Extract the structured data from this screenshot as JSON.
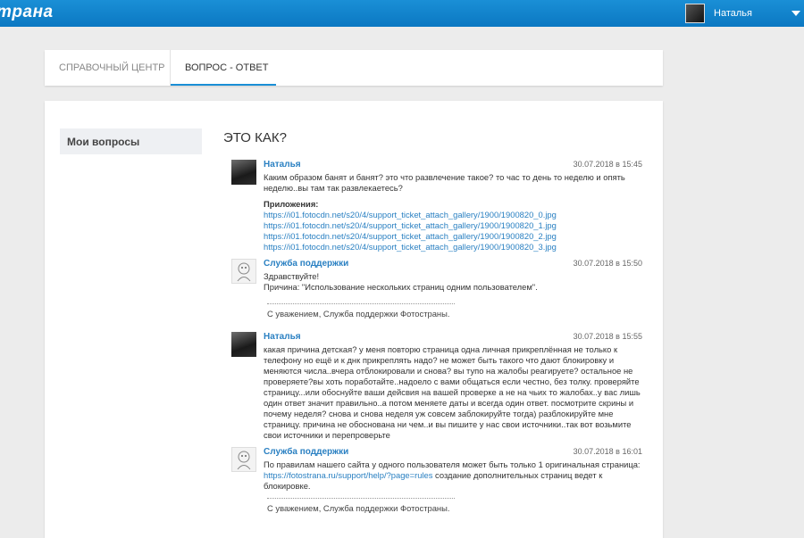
{
  "header": {
    "logo": "трана",
    "user_name": "Наталья"
  },
  "tabs": [
    {
      "label": "СПРАВОЧНЫЙ ЦЕНТР"
    },
    {
      "label": "ВОПРОС - ОТВЕТ"
    }
  ],
  "sidebar": {
    "item": "Мои вопросы"
  },
  "question": {
    "title": "ЭТО КАК?"
  },
  "messages": [
    {
      "author": "Наталья",
      "time": "30.07.2018 в 15:45",
      "text": "Каким образом банят и банят? это что развлечение такое? то час то день то неделю и опять неделю..вы там так развлекаетесь?",
      "attachments_label": "Приложения:",
      "attachments": [
        "https://i01.fotocdn.net/s20/4/support_ticket_attach_gallery/1900/1900820_0.jpg",
        "https://i01.fotocdn.net/s20/4/support_ticket_attach_gallery/1900/1900820_1.jpg",
        "https://i01.fotocdn.net/s20/4/support_ticket_attach_gallery/1900/1900820_2.jpg",
        "https://i01.fotocdn.net/s20/4/support_ticket_attach_gallery/1900/1900820_3.jpg"
      ]
    },
    {
      "author": "Служба поддержки",
      "time": "30.07.2018 в 15:50",
      "line1": "Здравствуйте!",
      "line2": "Причина: \"Использование нескольких страниц одним пользователем\".",
      "signature": "С уважением, Служба поддержки Фотостраны."
    },
    {
      "author": "Наталья",
      "time": "30.07.2018 в 15:55",
      "text": "какая причина детская? у меня повторю страница одна личная прикреплённая не только к телефону но ещё и к днк прикреплять надо? не может быть такого что дают блокировку и меняются числа..вчера отблокировали и снова? вы тупо на жалобы реагируете? остальное не проверяете?вы хоть поработайте..надоело с вами общаться если честно, без толку. проверяйте страницу...или обоснуйте ваши дейсвия на вашей проверке а не на чьих то жалобах..у вас лишь один ответ значит правильно..а потом меняете даты и всегда один ответ. посмотрите скрины и почему неделя? снова и снова неделя уж совсем заблокируйте тогда) разблокируйте мне страницу. причина не обоснована ни чем..и вы пишите у нас свои источники..так вот возьмите свои источники и перепроверьте"
    },
    {
      "author": "Служба поддержки",
      "time": "30.07.2018 в 16:01",
      "text_before": "По правилам нашего сайта у одного пользователя может быть только 1 оригинальная страница:",
      "link": "https://fotostrana.ru/support/help/?page=rules",
      "text_after": " создание дополнительных страниц ведет к блокировке.",
      "signature": "С уважением, Служба поддержки Фотостраны."
    }
  ]
}
